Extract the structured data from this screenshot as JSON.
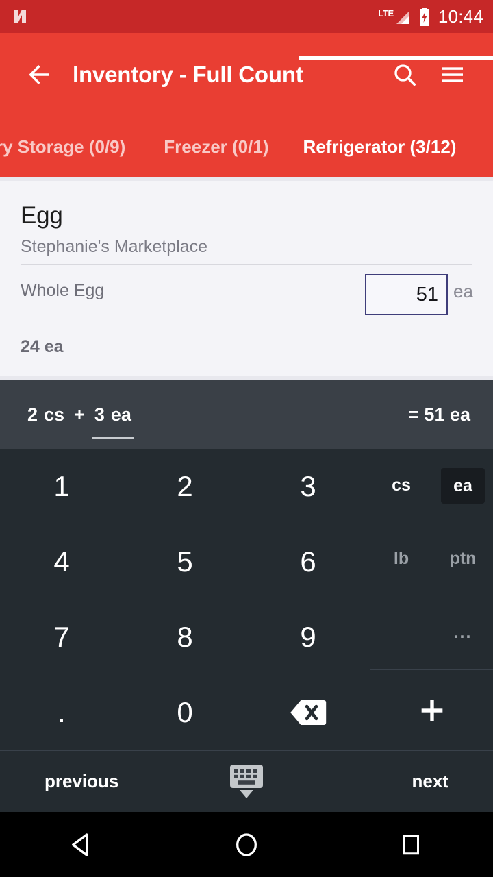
{
  "status_bar": {
    "logo_icon": "android-n-logo-icon",
    "network_label": "LTE",
    "signal_icon": "signal-bars-icon",
    "battery_icon": "battery-charging-icon",
    "time": "10:44"
  },
  "app_bar": {
    "back_icon": "arrow-back-icon",
    "title": "Inventory - Full Count",
    "search_icon": "search-icon",
    "menu_icon": "hamburger-menu-icon"
  },
  "tabs": {
    "items": [
      {
        "label": "ry Storage (0/9)",
        "active": false
      },
      {
        "label": "Freezer (0/1)",
        "active": false
      },
      {
        "label": "Refrigerator (3/12)",
        "active": true
      }
    ]
  },
  "card": {
    "title": "Egg",
    "vendor": "Stephanie's Marketplace",
    "row_label": "Whole Egg",
    "qty_value": "51",
    "qty_unit": "ea",
    "total": "24 ea",
    "border_color": "#3F3D7A"
  },
  "expression": {
    "term1_number": "2",
    "term1_unit": "cs",
    "operator": "+",
    "term2_number": "3",
    "term2_unit": "ea",
    "result": "= 51 ea"
  },
  "keypad": {
    "keys": [
      "1",
      "2",
      "3",
      "4",
      "5",
      "6",
      "7",
      "8",
      "9",
      ".",
      "0"
    ],
    "backspace_icon": "backspace-icon"
  },
  "units": {
    "buttons": [
      {
        "label": "cs",
        "state": "normal"
      },
      {
        "label": "ea",
        "state": "selected"
      },
      {
        "label": "lb",
        "state": "dim"
      },
      {
        "label": "ptn",
        "state": "dim"
      },
      {
        "label": "...",
        "state": "more"
      }
    ],
    "plus_icon": "plus-icon",
    "plus_label": "+"
  },
  "action_bar": {
    "previous_label": "previous",
    "keyboard_icon": "hide-keyboard-icon",
    "next_label": "next"
  },
  "nav_bar": {
    "back_icon": "nav-back-triangle-icon",
    "home_icon": "nav-home-circle-icon",
    "recents_icon": "nav-recents-square-icon"
  },
  "colors": {
    "status_bar": "#C62828",
    "app_bar": "#E93E33",
    "card_bg": "#F4F4F8",
    "expr_bar": "#3A4047",
    "keypad_bg": "#242B30",
    "selected_key": "#181C20"
  }
}
